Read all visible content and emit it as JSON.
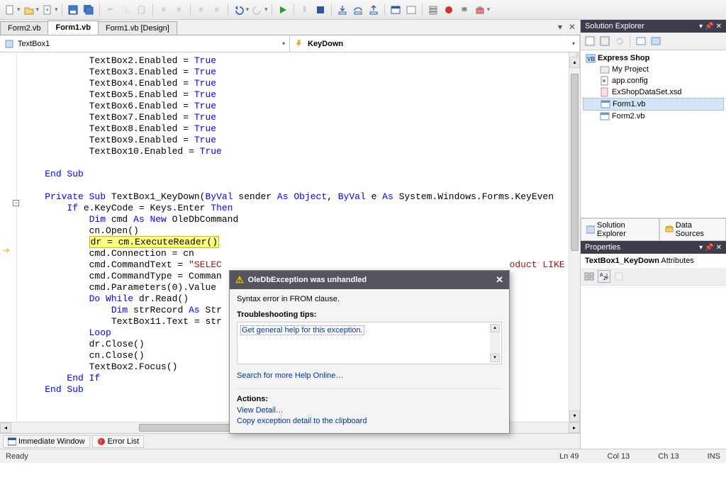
{
  "toolbar_buttons": [
    "new",
    "open",
    "save",
    "saveall",
    "cut",
    "copy",
    "paste",
    "undo",
    "redo",
    "start",
    "stop",
    "step",
    "stepover",
    "stepout",
    "breakpoint",
    "comment",
    "uncomment"
  ],
  "tabs": [
    {
      "label": "Form2.vb",
      "active": false
    },
    {
      "label": "Form1.vb",
      "active": true
    },
    {
      "label": "Form1.vb [Design]",
      "active": false
    }
  ],
  "dropdown_left": {
    "text": "TextBox1"
  },
  "dropdown_right": {
    "text": "KeyDown"
  },
  "code_lines": [
    {
      "indent": 3,
      "parts": [
        {
          "t": "TextBox2.Enabled = "
        },
        {
          "t": "True",
          "c": "kw"
        }
      ]
    },
    {
      "indent": 3,
      "parts": [
        {
          "t": "TextBox3.Enabled = "
        },
        {
          "t": "True",
          "c": "kw"
        }
      ]
    },
    {
      "indent": 3,
      "parts": [
        {
          "t": "TextBox4.Enabled = "
        },
        {
          "t": "True",
          "c": "kw"
        }
      ]
    },
    {
      "indent": 3,
      "parts": [
        {
          "t": "TextBox5.Enabled = "
        },
        {
          "t": "True",
          "c": "kw"
        }
      ]
    },
    {
      "indent": 3,
      "parts": [
        {
          "t": "TextBox6.Enabled = "
        },
        {
          "t": "True",
          "c": "kw"
        }
      ]
    },
    {
      "indent": 3,
      "parts": [
        {
          "t": "TextBox7.Enabled = "
        },
        {
          "t": "True",
          "c": "kw"
        }
      ]
    },
    {
      "indent": 3,
      "parts": [
        {
          "t": "TextBox8.Enabled = "
        },
        {
          "t": "True",
          "c": "kw"
        }
      ]
    },
    {
      "indent": 3,
      "parts": [
        {
          "t": "TextBox9.Enabled = "
        },
        {
          "t": "True",
          "c": "kw"
        }
      ]
    },
    {
      "indent": 3,
      "parts": [
        {
          "t": "TextBox10.Enabled = "
        },
        {
          "t": "True",
          "c": "kw"
        }
      ]
    },
    {
      "indent": 0,
      "parts": []
    },
    {
      "indent": 1,
      "parts": [
        {
          "t": "End Sub",
          "c": "kw"
        }
      ]
    },
    {
      "indent": 0,
      "parts": []
    },
    {
      "indent": 1,
      "parts": [
        {
          "t": "Private Sub",
          "c": "kw"
        },
        {
          "t": " TextBox1_KeyDown("
        },
        {
          "t": "ByVal",
          "c": "kw"
        },
        {
          "t": " sender "
        },
        {
          "t": "As Object",
          "c": "kw"
        },
        {
          "t": ", "
        },
        {
          "t": "ByVal",
          "c": "kw"
        },
        {
          "t": " e "
        },
        {
          "t": "As",
          "c": "kw"
        },
        {
          "t": " System.Windows.Forms.KeyEven"
        }
      ]
    },
    {
      "indent": 2,
      "parts": [
        {
          "t": "If",
          "c": "kw"
        },
        {
          "t": " e.KeyCode = Keys.Enter "
        },
        {
          "t": "Then",
          "c": "kw"
        }
      ]
    },
    {
      "indent": 3,
      "parts": [
        {
          "t": "Dim",
          "c": "kw"
        },
        {
          "t": " cmd "
        },
        {
          "t": "As New",
          "c": "kw"
        },
        {
          "t": " OleDbCommand"
        }
      ]
    },
    {
      "indent": 3,
      "parts": [
        {
          "t": "cn.Open()"
        }
      ]
    },
    {
      "indent": 3,
      "parts": [
        {
          "t": "dr = cm.ExecuteReader()",
          "c": "hl"
        }
      ],
      "highlighted": true
    },
    {
      "indent": 3,
      "parts": [
        {
          "t": "cmd.Connection = cn"
        }
      ]
    },
    {
      "indent": 3,
      "parts": [
        {
          "t": "cmd.CommandText = "
        },
        {
          "t": "\"SELEC",
          "c": "str"
        },
        {
          "t": "                                                    "
        },
        {
          "t": "oduct LIKE",
          "c": "str"
        }
      ]
    },
    {
      "indent": 3,
      "parts": [
        {
          "t": "cmd.CommandType = Comman"
        }
      ]
    },
    {
      "indent": 3,
      "parts": [
        {
          "t": "cmd.Parameters(0).Value "
        }
      ]
    },
    {
      "indent": 3,
      "parts": [
        {
          "t": "Do While",
          "c": "kw"
        },
        {
          "t": " dr.Read()"
        }
      ]
    },
    {
      "indent": 4,
      "parts": [
        {
          "t": "Dim",
          "c": "kw"
        },
        {
          "t": " strRecord "
        },
        {
          "t": "As",
          "c": "kw"
        },
        {
          "t": " Str"
        }
      ]
    },
    {
      "indent": 4,
      "parts": [
        {
          "t": "TextBox11.Text = str"
        }
      ]
    },
    {
      "indent": 3,
      "parts": [
        {
          "t": "Loop",
          "c": "kw"
        }
      ]
    },
    {
      "indent": 3,
      "parts": [
        {
          "t": "dr.Close()"
        }
      ]
    },
    {
      "indent": 3,
      "parts": [
        {
          "t": "cn.Close()"
        }
      ]
    },
    {
      "indent": 3,
      "parts": [
        {
          "t": "TextBox2.Focus()"
        }
      ]
    },
    {
      "indent": 2,
      "parts": [
        {
          "t": "End If",
          "c": "kw"
        }
      ]
    },
    {
      "indent": 1,
      "parts": [
        {
          "t": "End Sub",
          "c": "kw"
        }
      ]
    }
  ],
  "bottom_tabs": [
    {
      "label": "Immediate Window",
      "icon": "imm"
    },
    {
      "label": "Error List",
      "icon": "err"
    }
  ],
  "solution_explorer": {
    "title": "Solution Explorer",
    "root": "Express Shop",
    "children": [
      {
        "label": "My Project",
        "icon": "proj"
      },
      {
        "label": "app.config",
        "icon": "config"
      },
      {
        "label": "ExShopDataSet.xsd",
        "icon": "xsd"
      },
      {
        "label": "Form1.vb",
        "icon": "form",
        "selected": true
      },
      {
        "label": "Form2.vb",
        "icon": "form"
      }
    ]
  },
  "se_bottom_tabs": [
    {
      "label": "Solution Explorer"
    },
    {
      "label": "Data Sources"
    }
  ],
  "properties": {
    "title": "Properties",
    "object": "TextBox1_KeyDown",
    "type": "Attributes"
  },
  "exception": {
    "title": "OleDbException was unhandled",
    "message": "Syntax error in FROM clause.",
    "tips_label": "Troubleshooting tips:",
    "tip1": "Get general help for this exception.",
    "search_link": "Search for more Help Online…",
    "actions_label": "Actions:",
    "action1": "View Detail…",
    "action2": "Copy exception detail to the clipboard"
  },
  "status_bar": {
    "ready": "Ready",
    "ln": "Ln 49",
    "col": "Col 13",
    "ch": "Ch 13",
    "ins": "INS"
  }
}
